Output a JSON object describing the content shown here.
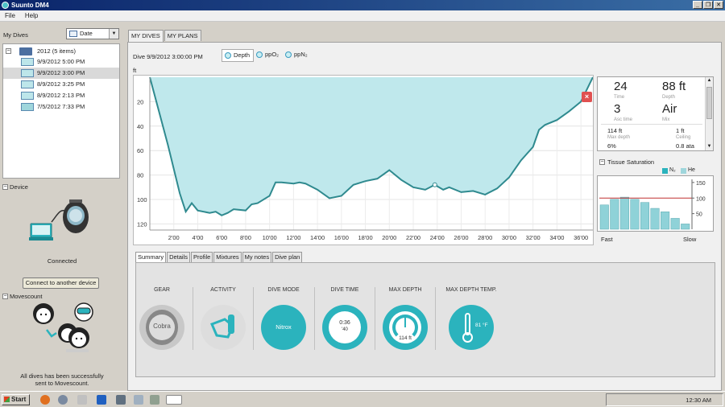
{
  "window": {
    "title": "Suunto DM4",
    "controls": [
      "_",
      "❐",
      "✕"
    ]
  },
  "menu": [
    "File",
    "Help"
  ],
  "left": {
    "my_dives_label": "My Dives",
    "sort_value": "Date",
    "tree": {
      "group": "2012 (5 items)",
      "items": [
        "9/9/2012 5:00 PM",
        "9/9/2012 3:00 PM",
        "8/9/2012 3:25 PM",
        "8/9/2012 2:13 PM",
        "7/5/2012 7:33 PM"
      ]
    },
    "device_section": "Device",
    "device_status": "Connected",
    "connect_button": "Connect to another device",
    "movescount_section": "Movescount",
    "movescount_msg1": "All dives has been successfully",
    "movescount_msg2": "sent to Movescount."
  },
  "tabs": [
    "MY DIVES",
    "MY PLANS"
  ],
  "dive": {
    "title": "Dive 9/9/2012 3:00:00 PM",
    "graph_tabs": [
      "Depth",
      "ppO₂",
      "ppN₂"
    ],
    "unit": "ft"
  },
  "chart_data": {
    "type": "area",
    "title": "",
    "ylabel": "ft",
    "xlim": [
      0,
      37
    ],
    "ylim": [
      0,
      125
    ],
    "y_inverted": true,
    "yticks": [
      20,
      40,
      60,
      80,
      100,
      120
    ],
    "xtick_labels": [
      "2'00",
      "4'00",
      "6'00",
      "8'00",
      "10'00",
      "12'00",
      "14'00",
      "16'00",
      "18'00",
      "20'00",
      "22'00",
      "24'00",
      "26'00",
      "28'00",
      "30'00",
      "32'00",
      "34'00",
      "36'00"
    ],
    "xticks": [
      2,
      4,
      6,
      8,
      10,
      12,
      14,
      16,
      18,
      20,
      22,
      24,
      26,
      28,
      30,
      32,
      34,
      36
    ],
    "x": [
      0,
      1.5,
      2.5,
      3,
      3.5,
      4,
      5,
      5.5,
      6,
      6.5,
      7,
      8,
      8.5,
      9,
      10,
      10.5,
      11,
      12,
      12.5,
      13,
      14,
      15,
      16,
      17,
      18,
      19,
      20,
      21,
      22,
      23,
      23.8,
      24.5,
      25,
      26,
      27,
      28,
      29,
      30,
      31,
      32,
      32.5,
      33,
      34,
      35,
      35.5,
      36,
      37
    ],
    "values": [
      0,
      55,
      95,
      110,
      103,
      109,
      111,
      110,
      113,
      111,
      108,
      109,
      104,
      103,
      97,
      86,
      86,
      87,
      86,
      87,
      92,
      99,
      97,
      88,
      85,
      83,
      76,
      84,
      90,
      92,
      88,
      92,
      90,
      94,
      93,
      96,
      91,
      82,
      68,
      57,
      43,
      39,
      35,
      28,
      24,
      20,
      0
    ],
    "grid": true
  },
  "info": {
    "time_val": "24",
    "time_lab": "Time",
    "depth_val": "88 ft",
    "depth_lab": "Depth",
    "asc_val": "3",
    "asc_lab": "Asc time",
    "mix_val": "Air",
    "mix_lab": "Mix",
    "maxdepth_val": "114 ft",
    "maxdepth_lab": "Max depth",
    "ceiling_val": "1 ft",
    "ceiling_lab": "Ceiling",
    "row3_left": "6%",
    "row3_right": "0.8 ata"
  },
  "tissue": {
    "heading": "Tissue Saturation",
    "legend": [
      "N₂",
      "He"
    ],
    "yticks": [
      50,
      100,
      150
    ],
    "bars": [
      78,
      96,
      103,
      96,
      86,
      67,
      56,
      35,
      17
    ],
    "fast_label": "Fast",
    "slow_label": "Slow",
    "colors": {
      "bar": "#8fd2d8",
      "line": "#c03030"
    }
  },
  "subtabs": [
    "Summary",
    "Details",
    "Profile",
    "Mixtures",
    "My notes",
    "Dive plan"
  ],
  "summary": {
    "gear_label": "GEAR",
    "gear_value": "Cobra",
    "activity_label": "ACTIVITY",
    "divemode_label": "DIVE MODE",
    "divemode_value": "Nitrox",
    "divetime_label": "DIVE TIME",
    "divetime_value": "0:36",
    "divetime_sec": "'40",
    "maxdepth_label": "MAX DEPTH",
    "maxdepth_value": "114 ft",
    "maxtemp_label": "MAX DEPTH TEMP.",
    "maxtemp_value": "81 °F"
  },
  "taskbar": {
    "start": "Start",
    "clock": "12:30 AM"
  },
  "colors": {
    "accent": "#2bb3bd",
    "area": "#bfe8ec",
    "line": "#2f8a8f"
  }
}
